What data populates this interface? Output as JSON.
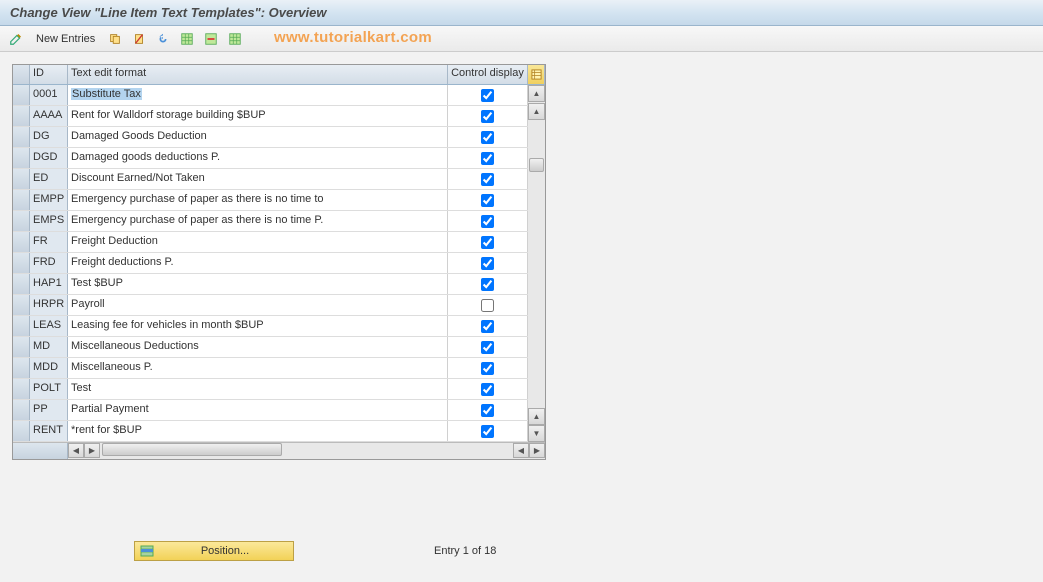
{
  "title": "Change View \"Line Item Text Templates\": Overview",
  "watermark": "www.tutorialkart.com",
  "toolbar": {
    "new_entries": "New Entries"
  },
  "columns": {
    "id": "ID",
    "text": "Text edit format",
    "control": "Control display"
  },
  "rows": [
    {
      "id": "0001",
      "text": "Substitute Tax",
      "checked": true,
      "highlight": true
    },
    {
      "id": "AAAA",
      "text": "Rent for Walldorf storage building $BUP",
      "checked": true
    },
    {
      "id": "DG",
      "text": "Damaged Goods Deduction",
      "checked": true
    },
    {
      "id": "DGD",
      "text": "Damaged goods deductions P.",
      "checked": true
    },
    {
      "id": "ED",
      "text": "Discount Earned/Not Taken",
      "checked": true
    },
    {
      "id": "EMPP",
      "text": "Emergency purchase of paper as there is no time to",
      "checked": true
    },
    {
      "id": "EMPS",
      "text": "Emergency purchase of paper as there is no time P.",
      "checked": true
    },
    {
      "id": "FR",
      "text": "Freight Deduction",
      "checked": true
    },
    {
      "id": "FRD",
      "text": "Freight deductions P.",
      "checked": true
    },
    {
      "id": "HAP1",
      "text": "Test $BUP",
      "checked": true
    },
    {
      "id": "HRPR",
      "text": "Payroll",
      "checked": false
    },
    {
      "id": "LEAS",
      "text": "Leasing fee for vehicles in month $BUP",
      "checked": true
    },
    {
      "id": "MD",
      "text": "Miscellaneous Deductions",
      "checked": true
    },
    {
      "id": "MDD",
      "text": "Miscellaneous P.",
      "checked": true
    },
    {
      "id": "POLT",
      "text": "Test",
      "checked": true
    },
    {
      "id": "PP",
      "text": "Partial Payment",
      "checked": true
    },
    {
      "id": "RENT",
      "text": "*rent for $BUP",
      "checked": true
    }
  ],
  "footer": {
    "position_label": "Position...",
    "entry_text": "Entry 1 of 18"
  }
}
